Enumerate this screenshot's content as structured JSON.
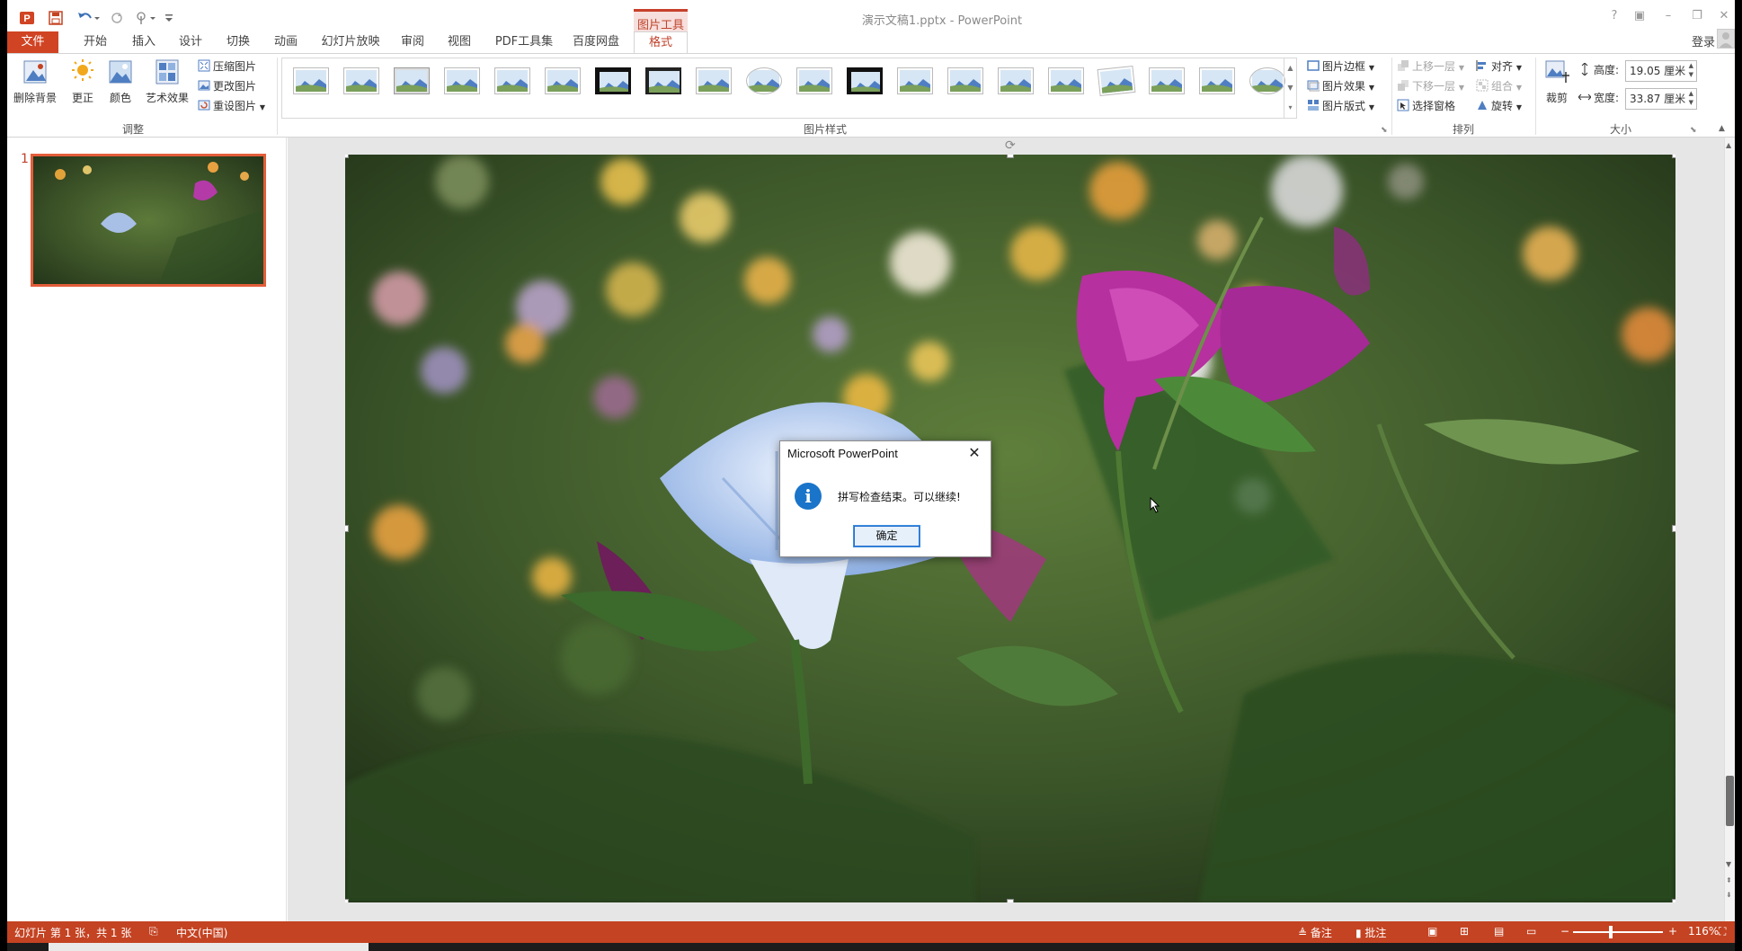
{
  "window": {
    "title": "演示文稿1.pptx - PowerPoint",
    "context_tab_group": "图片工具",
    "login": "登录",
    "controls": [
      "?",
      "▣",
      "–",
      "❐",
      "✕"
    ]
  },
  "tabs": [
    {
      "label": "文件",
      "active": false
    },
    {
      "label": "开始"
    },
    {
      "label": "插入"
    },
    {
      "label": "设计"
    },
    {
      "label": "切换"
    },
    {
      "label": "动画"
    },
    {
      "label": "幻灯片放映"
    },
    {
      "label": "审阅"
    },
    {
      "label": "视图"
    },
    {
      "label": "PDF工具集"
    },
    {
      "label": "百度网盘"
    },
    {
      "label": "格式",
      "active": true
    }
  ],
  "ribbon": {
    "adjust": {
      "group_label": "调整",
      "remove_bg": "删除背景",
      "corrections": "更正",
      "color": "颜色",
      "artistic": "艺术效果",
      "compress": "压缩图片",
      "change": "更改图片",
      "reset": "重设图片"
    },
    "styles": {
      "group_label": "图片样式",
      "border": "图片边框",
      "effects": "图片效果",
      "layout": "图片版式",
      "thumb_count": 20
    },
    "arrange": {
      "group_label": "排列",
      "bring_forward": "上移一层",
      "send_backward": "下移一层",
      "selection_pane": "选择窗格",
      "align": "对齐",
      "group": "组合",
      "rotate": "旋转"
    },
    "size": {
      "group_label": "大小",
      "crop": "裁剪",
      "height_label": "高度:",
      "height_value": "19.05 厘米",
      "width_label": "宽度:",
      "width_value": "33.87 厘米"
    }
  },
  "thumbnails": {
    "slide_number": "1"
  },
  "dialog": {
    "title": "Microsoft PowerPoint",
    "message": "拼写检查结束。可以继续!",
    "ok": "确定"
  },
  "statusbar": {
    "slide_info": "幻灯片 第 1 张，共 1 张",
    "language": "中文(中国)",
    "notes": "备注",
    "comments": "批注",
    "zoom": "116%"
  },
  "colors": {
    "accent": "#c44322",
    "file_tab": "#d04424",
    "format_tab_text": "#c0412b",
    "info_icon": "#1a74c9"
  }
}
